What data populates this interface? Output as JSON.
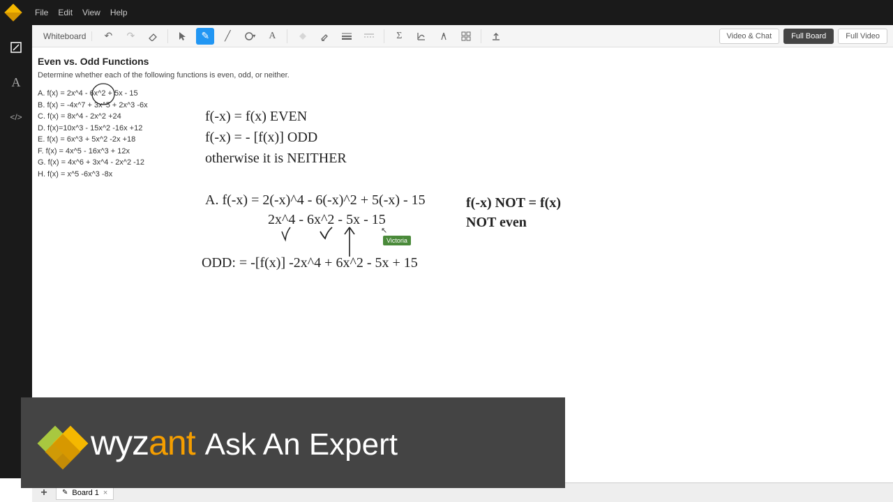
{
  "menu": {
    "file": "File",
    "edit": "Edit",
    "view": "View",
    "help": "Help"
  },
  "toolbar": {
    "label": "Whiteboard",
    "right": {
      "video": "Video & Chat",
      "full": "Full Board",
      "fullvid": "Full Video"
    }
  },
  "content": {
    "title": "Even vs. Odd Functions",
    "subtitle": "Determine whether each of the following functions is even, odd, or neither.",
    "problems": {
      "a": "A. f(x) = 2x^4 - 6x^2 + 5x - 15",
      "b": "B. f(x) = -4x^7 + 3x^5 + 2x^3 -6x",
      "c": "C. f(x) = 8x^4 - 2x^2 +24",
      "d": "D. f(x)=10x^3 - 15x^2 -16x +12",
      "e": "E. f(x) = 6x^3 + 5x^2 -2x +18",
      "f": "F. f(x) = 4x^5 - 16x^3 + 12x",
      "g": "G. f(x) = 4x^6 + 3x^4 - 2x^2 -12",
      "h": "H. f(x) = x^5 -6x^3 -8x"
    },
    "rules": {
      "l1": "f(-x) = f(x)  EVEN",
      "l2": "f(-x) = - [f(x)] ODD",
      "l3": "otherwise it is NEITHER"
    },
    "work": {
      "a1": "A.  f(-x) = 2(-x)^4 - 6(-x)^2 + 5(-x) - 15",
      "a2": "2x^4 - 6x^2 - 5x - 15",
      "odd": "ODD:  = -[f(x)]  -2x^4 + 6x^2 - 5x + 15",
      "note1": "f(-x) NOT = f(x)",
      "note2": "NOT even"
    },
    "user_tag": "Victoria"
  },
  "tabs": {
    "board1": "Board 1"
  },
  "overlay": {
    "brand_a": "wyz",
    "brand_b": "ant",
    "tagline": "Ask An Expert"
  }
}
